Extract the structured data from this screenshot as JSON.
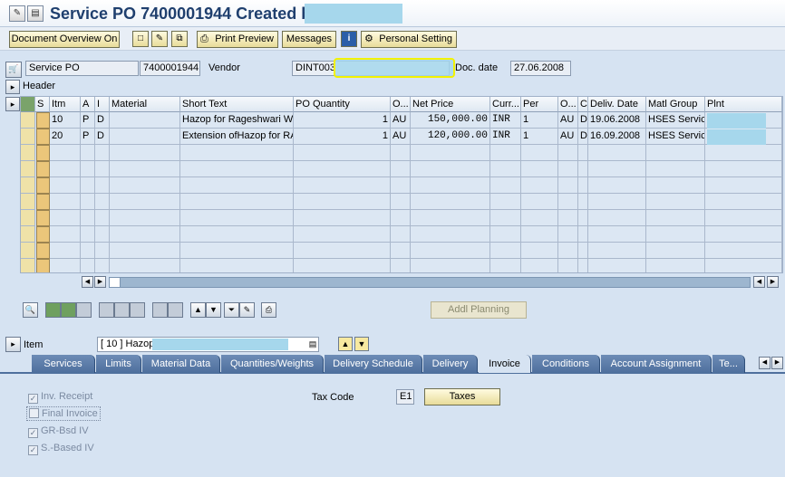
{
  "window": {
    "title": "Service PO 7400001944 Created by"
  },
  "toolbar": {
    "doc_overview": "Document Overview On",
    "print_preview": "Print Preview",
    "messages": "Messages",
    "personal_setting": "Personal Setting"
  },
  "header_fields": {
    "doc_type": "Service PO",
    "po_number": "7400001944",
    "vendor_label": "Vendor",
    "vendor_code": "DINT003",
    "doc_date_label": "Doc. date",
    "doc_date": "27.06.2008",
    "header_label": "Header"
  },
  "grid": {
    "columns": [
      "S",
      "Itm",
      "A",
      "I",
      "Material",
      "Short Text",
      "PO Quantity",
      "O...",
      "Net Price",
      "Curr...",
      "Per",
      "O...",
      "C",
      "Deliv. Date",
      "Matl Group",
      "Plnt"
    ],
    "rows": [
      {
        "itm": "10",
        "a": "P",
        "i": "D",
        "material": "",
        "short_text": "Hazop for Rageshwari We",
        "qty": "1",
        "unit": "AU",
        "net_price": "150,000.00",
        "curr": "INR",
        "per": "1",
        "ounit": "AU",
        "c": "D",
        "deliv": "19.06.2008",
        "matl": "HSES Service"
      },
      {
        "itm": "20",
        "a": "P",
        "i": "D",
        "material": "",
        "short_text": "Extension ofHazop for RAA",
        "qty": "1",
        "unit": "AU",
        "net_price": "120,000.00",
        "curr": "INR",
        "per": "1",
        "ounit": "AU",
        "c": "D",
        "deliv": "16.09.2008",
        "matl": "HSES Service"
      }
    ]
  },
  "actions": {
    "addl_planning": "Addl Planning"
  },
  "item": {
    "label": "Item",
    "value": "[ 10 ] Hazop"
  },
  "tabs": [
    "Services",
    "Limits",
    "Material Data",
    "Quantities/Weights",
    "Delivery Schedule",
    "Delivery",
    "Invoice",
    "Conditions",
    "Account Assignment",
    "Te..."
  ],
  "invoice": {
    "inv_receipt": "Inv. Receipt",
    "final_invoice": "Final Invoice",
    "gr_bsd_iv": "GR-Bsd IV",
    "s_based_iv": "S.-Based IV",
    "tax_code_label": "Tax Code",
    "tax_code": "E1",
    "taxes_button": "Taxes"
  },
  "icons": [
    "display-change-icon",
    "save-icon",
    "new-doc-icon",
    "edit-icon",
    "copy-icon",
    "print-icon",
    "info-icon",
    "settings-icon",
    "cart-icon",
    "header-icon",
    "scroll-left-icon",
    "scroll-right-icon",
    "up-arrow-icon",
    "down-arrow-icon"
  ],
  "colors": {
    "background": "#d6e3f2",
    "title": "#1f3f6e",
    "tab": "#4e6f9d",
    "highlight": "#fff300"
  }
}
